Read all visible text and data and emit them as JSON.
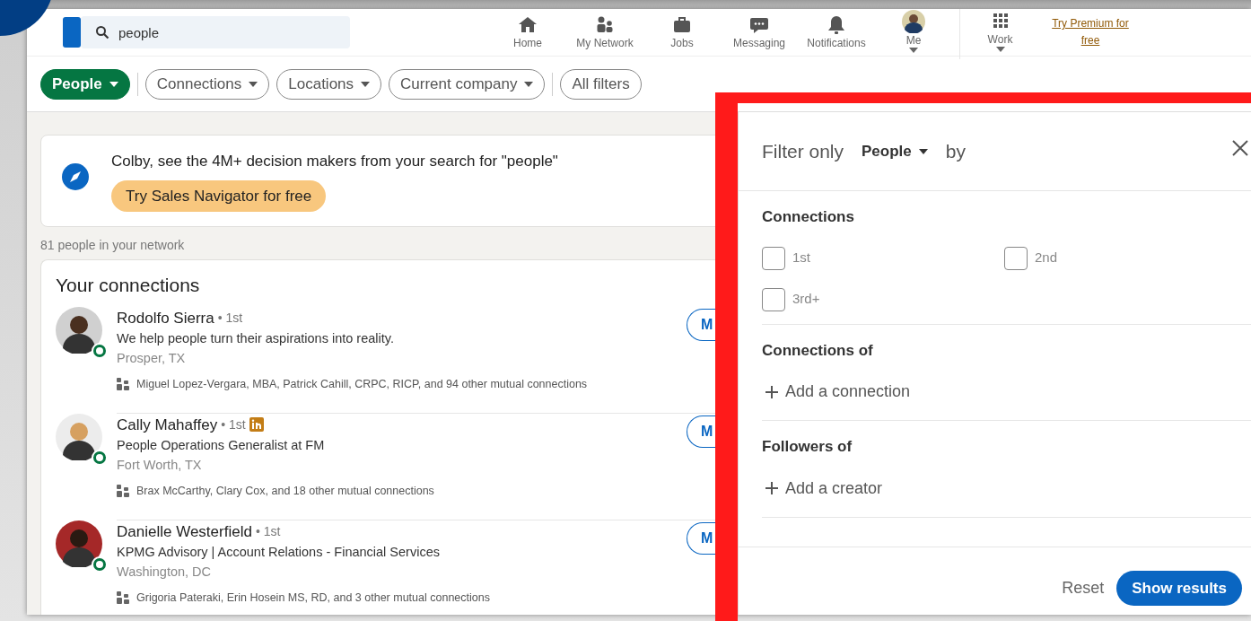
{
  "nav": {
    "search": {
      "value": "people"
    },
    "items": [
      {
        "label": "Home",
        "kind": "home",
        "dropdown": false
      },
      {
        "label": "My Network",
        "kind": "network",
        "dropdown": false
      },
      {
        "label": "Jobs",
        "kind": "jobs",
        "dropdown": false
      },
      {
        "label": "Messaging",
        "kind": "messaging",
        "dropdown": false
      },
      {
        "label": "Notifications",
        "kind": "bell",
        "dropdown": false
      },
      {
        "label": "Me",
        "kind": "avatar",
        "dropdown": true
      },
      {
        "label": "Work",
        "kind": "grid",
        "dropdown": true
      }
    ],
    "premium_link": "Try Premium for free"
  },
  "filters": [
    {
      "label": "People",
      "selected": true,
      "dropdown": true
    },
    {
      "label": "Connections",
      "selected": false,
      "dropdown": true
    },
    {
      "label": "Locations",
      "selected": false,
      "dropdown": true
    },
    {
      "label": "Current company",
      "selected": false,
      "dropdown": true
    },
    {
      "label": "All filters",
      "selected": false,
      "dropdown": false
    }
  ],
  "promo": {
    "text": "Colby, see the 4M+ decision makers from your search for \"people\"",
    "button": "Try Sales Navigator for free"
  },
  "network_count": "81 people in your network",
  "connections": {
    "title": "Your connections",
    "people": [
      {
        "name": "Rodolfo Sierra",
        "degree": "• 1st",
        "premium": false,
        "online": true,
        "headline": "We help people turn their aspirations into reality.",
        "location": "Prosper, TX",
        "mutual": "Miguel Lopez-Vergara, MBA, Patrick Cahill, CRPC, RICP, and 94 other mutual connections",
        "button": "M"
      },
      {
        "name": "Cally Mahaffey",
        "degree": "• 1st",
        "premium": true,
        "online": true,
        "headline": "People Operations Generalist at FM",
        "location": "Fort Worth, TX",
        "mutual": "Brax McCarthy, Clary Cox, and 18 other mutual connections",
        "button": "M"
      },
      {
        "name": "Danielle Westerfield",
        "degree": "• 1st",
        "premium": false,
        "online": true,
        "headline": "KPMG Advisory | Account Relations - Financial Services",
        "location": "Washington, DC",
        "mutual": "Grigoria Pateraki, Erin Hosein MS, RD, and 3 other mutual connections",
        "button": "M"
      }
    ]
  },
  "filter_panel": {
    "title": "Filter only",
    "type": "People",
    "by": "by",
    "sections": [
      {
        "title": "Connections",
        "kind": "checkboxes",
        "options": [
          {
            "label": "1st",
            "checked": false
          },
          {
            "label": "2nd",
            "checked": false
          },
          {
            "label": "3rd+",
            "checked": false
          }
        ]
      },
      {
        "title": "Connections of",
        "kind": "add",
        "add": "Add a connection"
      },
      {
        "title": "Followers of",
        "kind": "add",
        "add": "Add a creator"
      }
    ],
    "reset": "Reset",
    "submit": "Show results"
  }
}
